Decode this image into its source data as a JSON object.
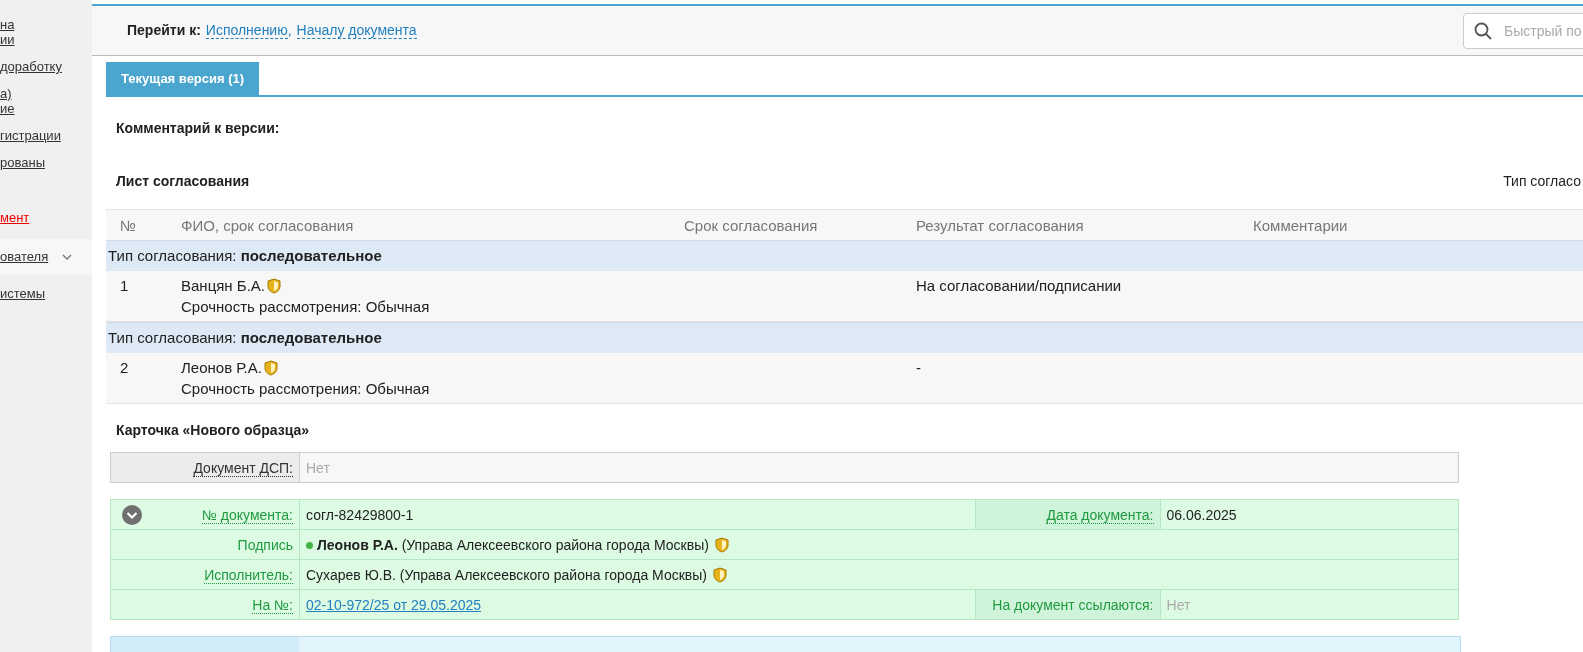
{
  "sidebar": {
    "items": [
      {
        "lines": [
          "на",
          "ии"
        ],
        "kind": "link"
      },
      {
        "lines": [
          "доработку"
        ],
        "kind": "link"
      },
      {
        "lines": [
          "а)",
          "ие"
        ],
        "kind": "link"
      },
      {
        "lines": [
          "гистрации"
        ],
        "kind": "link"
      },
      {
        "lines": [
          "рованы"
        ],
        "kind": "link"
      },
      {
        "lines": [
          "мент"
        ],
        "kind": "alert"
      },
      {
        "lines": [
          "ователя"
        ],
        "kind": "group",
        "expanded": false
      },
      {
        "lines": [
          "истемы"
        ],
        "kind": "link"
      }
    ]
  },
  "goto": {
    "label": "Перейти к:",
    "links": [
      "Исполнению",
      "Началу документа"
    ],
    "separator": ","
  },
  "search": {
    "placeholder": "Быстрый по"
  },
  "tabs": [
    {
      "label": "Текущая версия (1)",
      "selected": true
    }
  ],
  "version_comment": {
    "label": "Комментарий к версии:"
  },
  "approval_sheet": {
    "title": "Лист согласования",
    "right_label": "Тип согласо",
    "columns": [
      "№",
      "ФИО, срок согласования",
      "Срок согласования",
      "Результат согласования",
      "Комментарии"
    ],
    "groups": [
      {
        "type_label": "Тип согласования:",
        "type_value": "последовательное",
        "rows": [
          {
            "number": "1",
            "name": "Ванцян Б.А.",
            "urgency": "Срочность рассмотрения: Обычная",
            "result": "На согласовании/подписании"
          }
        ]
      },
      {
        "type_label": "Тип согласования:",
        "type_value": "последовательное",
        "rows": [
          {
            "number": "2",
            "name": "Леонов Р.А.",
            "urgency": "Срочность рассмотрения: Обычная",
            "result": "-"
          }
        ]
      }
    ]
  },
  "card": {
    "title": "Карточка «Нового образца»",
    "dsp": {
      "label": "Документ ДСП:",
      "value": "Нет",
      "empty": true
    },
    "main": {
      "expanded": true,
      "doc_number": {
        "label": "№ документа:",
        "value": "согл-82429800-1",
        "underlined": true
      },
      "doc_date": {
        "label": "Дата документа:",
        "value": "06.06.2025",
        "underlined": true
      },
      "signature": {
        "label": "Подпись",
        "name": "Леонов Р.А.",
        "org": "(Управа Алексеевского района города Москвы)",
        "underlined": false
      },
      "executor": {
        "label": "Исполнитель:",
        "value": "Сухарев Ю.В. (Управа Алексеевского района города Москвы)",
        "underlined": true
      },
      "reply_to": {
        "label": "На №:",
        "value": "02-10-972/25 от 29.05.2025",
        "underlined": true
      },
      "referenced_by": {
        "label": "На документ ссылаются:",
        "value": "Нет",
        "underlined": false,
        "empty": true
      }
    }
  }
}
